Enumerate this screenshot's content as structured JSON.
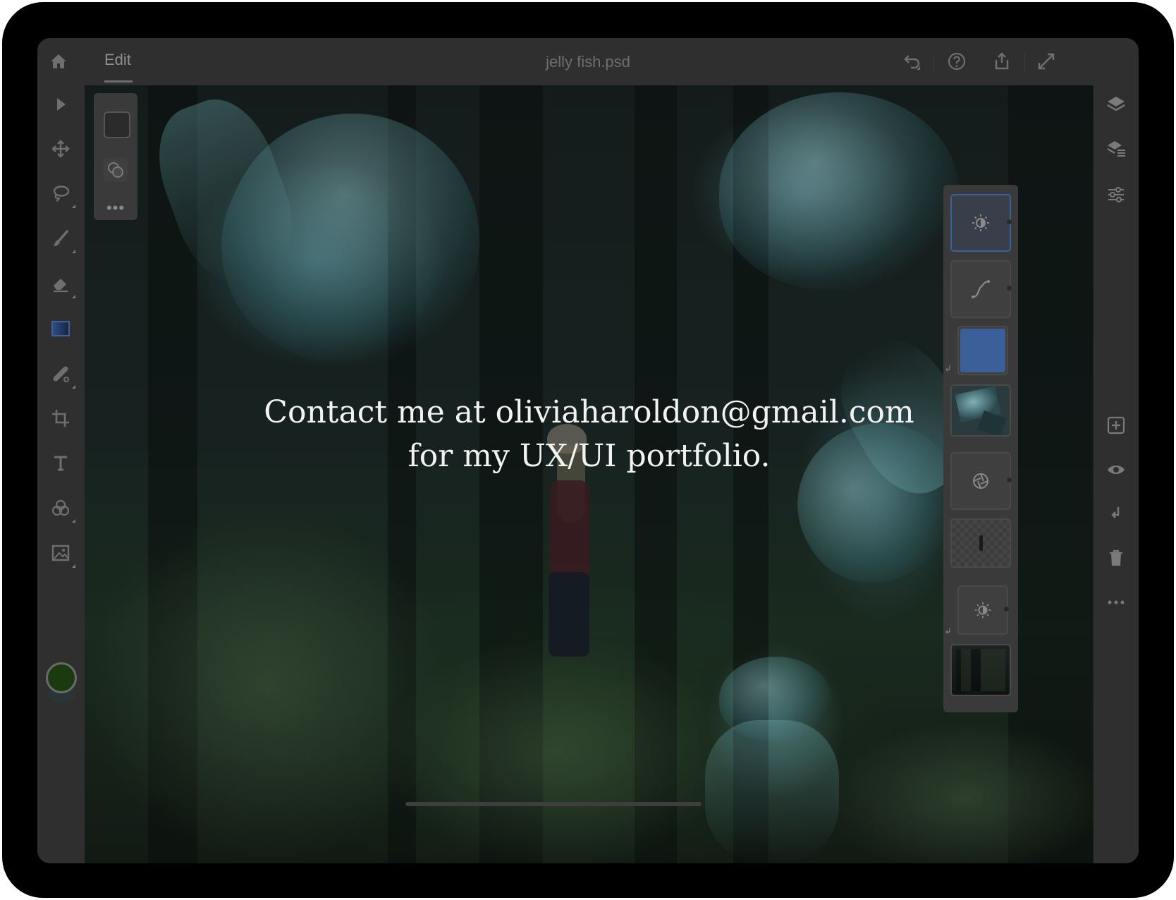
{
  "topbar": {
    "home_icon": "home-icon",
    "mode_tab": "Edit",
    "document_title": "jelly fish.psd",
    "undo_icon": "undo-icon",
    "help_icon": "help-icon",
    "share_icon": "share-icon",
    "expand_icon": "expand-icon"
  },
  "left_toolbar": {
    "tools": [
      "select-tool-icon",
      "move-tool-icon",
      "lasso-tool-icon",
      "brush-tool-icon",
      "eraser-tool-icon",
      "gradient-tool-icon",
      "healing-tool-icon",
      "crop-tool-icon",
      "type-tool-icon",
      "adjustment-tool-icon",
      "place-image-tool-icon"
    ],
    "foreground_color": "#1c3a10"
  },
  "tool_options": {
    "swatch_color": "#2b2b2b",
    "blend_icon": "blend-mode-icon",
    "more_icon": "more-options-icon",
    "more_label": "•••"
  },
  "layers": [
    {
      "type": "brightness-adjustment",
      "icon": "brightness-icon",
      "selected": true
    },
    {
      "type": "curves-adjustment",
      "icon": "curves-icon",
      "selected": false
    },
    {
      "type": "color-fill",
      "color": "#3b5f99",
      "selected": false
    },
    {
      "type": "jellyfish-image",
      "selected": false
    },
    {
      "type": "aperture-adjustment",
      "icon": "aperture-icon",
      "selected": false
    },
    {
      "type": "person-cutout",
      "selected": false
    },
    {
      "type": "brightness-adjustment",
      "icon": "brightness-icon",
      "selected": false
    },
    {
      "type": "forest-background",
      "selected": false
    }
  ],
  "right_toolbar": {
    "icons": [
      "layers-icon",
      "layer-properties-icon",
      "adjustments-icon",
      "add-layer-icon",
      "visibility-icon",
      "merge-down-icon",
      "delete-icon",
      "more-icon"
    ]
  },
  "overlay_message": {
    "line1": "Contact me at oliviaharoldon@gmail.com",
    "line2": "for my UX/UI portfolio."
  },
  "colors": {
    "accent_selected": "#3a5f9a",
    "chrome": "#2f2f2f"
  }
}
